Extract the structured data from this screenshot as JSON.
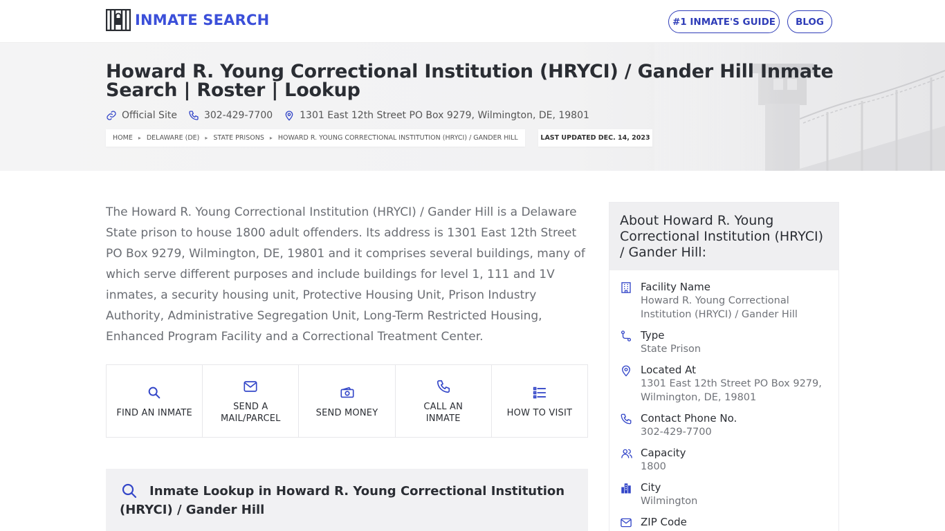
{
  "header": {
    "brand": "INMATE SEARCH",
    "nav": [
      {
        "label": "#1 INMATE'S GUIDE"
      },
      {
        "label": "BLOG"
      }
    ]
  },
  "hero": {
    "title": "Howard R. Young Correctional Institution (HRYCI) / Gander Hill Inmate Search | Roster | Lookup",
    "official_site": "Official Site",
    "phone": "302-429-7700",
    "address": "1301 East 12th Street PO Box 9279, Wilmington, DE, 19801",
    "breadcrumbs": [
      "HOME",
      "DELAWARE (DE)",
      "STATE PRISONS",
      "HOWARD R. YOUNG CORRECTIONAL INSTITUTION (HRYCI) / GANDER HILL"
    ],
    "last_updated": "LAST UPDATED DEC. 14, 2023"
  },
  "intro": "The Howard R. Young Correctional Institution (HRYCI) / Gander Hill is a Delaware State prison to house 1800 adult offenders. Its address is 1301 East 12th Street PO Box 9279, Wilmington, DE, 19801 and it comprises several buildings, many of which serve different purposes and include buildings for level 1, 111 and 1V inmates, a security housing unit, Protective Housing Unit, Prison Industry Authority, Administrative Segregation Unit, Long-Term Restricted Housing, Enhanced Program Facility and a Correctional Treatment Center.",
  "actions": [
    {
      "label": "FIND AN INMATE",
      "icon": "search-icon"
    },
    {
      "label": "SEND A MAIL/PARCEL",
      "icon": "mail-icon"
    },
    {
      "label": "SEND MONEY",
      "icon": "money-icon"
    },
    {
      "label": "CALL AN INMATE",
      "icon": "phone-icon"
    },
    {
      "label": "HOW TO VISIT",
      "icon": "list-icon"
    }
  ],
  "lookup": {
    "title": "Inmate Lookup in Howard R. Young Correctional Institution (HRYCI) / Gander Hill"
  },
  "sidebar": {
    "title": "About Howard R. Young Correctional Institution (HRYCI) / Gander Hill:",
    "facts": [
      {
        "label": "Facility Name",
        "value": "Howard R. Young Correctional Institution (HRYCI) / Gander Hill",
        "icon": "building-icon"
      },
      {
        "label": "Type",
        "value": "State Prison",
        "icon": "route-icon"
      },
      {
        "label": "Located At",
        "value": "1301 East 12th Street PO Box 9279, Wilmington, DE, 19801",
        "icon": "location-pin-icon"
      },
      {
        "label": "Contact Phone No.",
        "value": "302-429-7700",
        "icon": "phone-icon"
      },
      {
        "label": "Capacity",
        "value": "1800",
        "icon": "users-icon"
      },
      {
        "label": "City",
        "value": "Wilmington",
        "icon": "city-icon"
      },
      {
        "label": "ZIP Code",
        "value": "",
        "icon": "mail-icon"
      }
    ]
  },
  "colors": {
    "accent": "#3b4fd9",
    "nav_border": "#2f3db8",
    "icon": "#3346c8"
  }
}
